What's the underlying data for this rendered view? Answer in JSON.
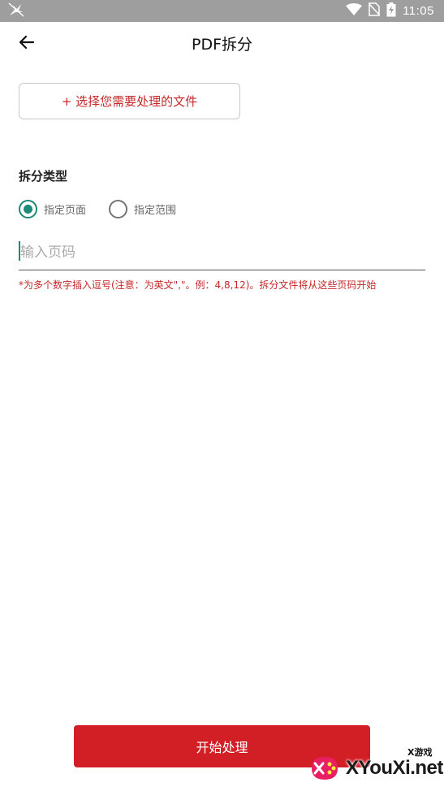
{
  "status_bar": {
    "time": "11:05"
  },
  "app_bar": {
    "title": "PDF拆分"
  },
  "select_file": {
    "label": "+ 选择您需要处理的文件"
  },
  "split_type": {
    "label": "拆分类型",
    "options": [
      {
        "label": "指定页面",
        "checked": true
      },
      {
        "label": "指定范围",
        "checked": false
      }
    ]
  },
  "page_input": {
    "placeholder": "输入页码",
    "value": ""
  },
  "hint": "*为多个数字插入逗号(注意：为英文\",\"。例：4,8,12)。拆分文件将从这些页码开始",
  "start_button": {
    "label": "开始处理"
  },
  "watermark": {
    "brand": "XYouXi.net",
    "small": "X游戏"
  },
  "colors": {
    "accent_red": "#d21f26",
    "radio_teal": "#1e8a7a",
    "status_bar": "#9e9e9e"
  }
}
